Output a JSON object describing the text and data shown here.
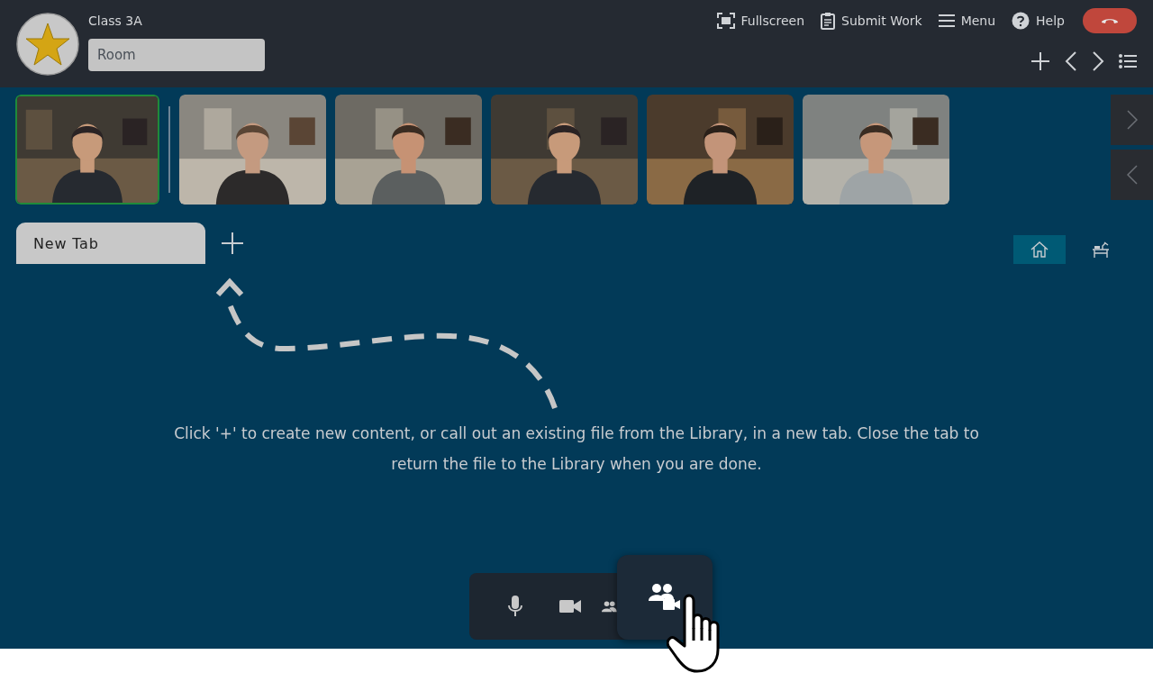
{
  "header": {
    "class_name": "Class 3A",
    "room_field": {
      "placeholder": "Room"
    },
    "actions": [
      {
        "kind": "fullscreen",
        "label": "Fullscreen"
      },
      {
        "kind": "submit",
        "label": "Submit Work"
      },
      {
        "kind": "menu",
        "label": "Menu"
      },
      {
        "kind": "help",
        "label": "Help"
      }
    ]
  },
  "participants": [
    {
      "selected": true
    },
    {
      "selected": false
    },
    {
      "selected": false
    },
    {
      "selected": false
    },
    {
      "selected": false
    },
    {
      "selected": false
    }
  ],
  "tabs": [
    {
      "label": "New Tab",
      "selected": true
    }
  ],
  "views": [
    {
      "kind": "home",
      "selected": true
    },
    {
      "kind": "desk",
      "selected": false
    }
  ],
  "message": "Click '+' to create new content, or call out an existing file from the Library, in a new tab. Close the tab to return the file to the Library when you are done.",
  "toolbar": [
    {
      "kind": "mic",
      "selected": false
    },
    {
      "kind": "camera",
      "selected": false
    },
    {
      "kind": "people",
      "selected": false
    },
    {
      "kind": "people-camera",
      "selected": true
    }
  ]
}
